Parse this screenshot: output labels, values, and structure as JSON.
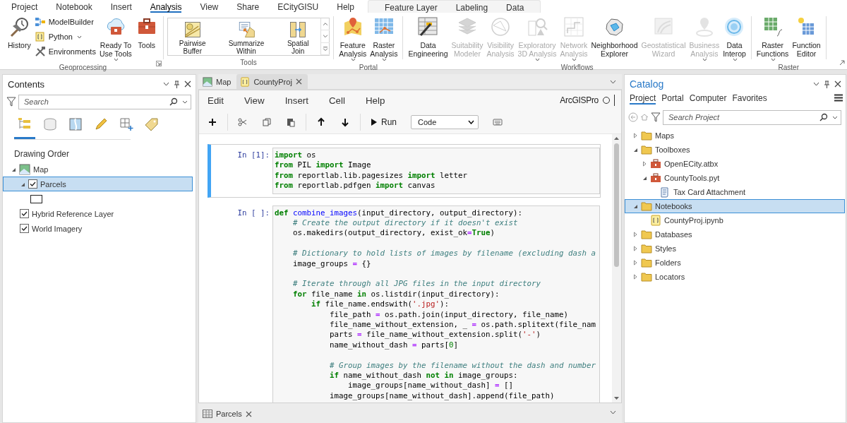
{
  "menu": {
    "tabs": [
      {
        "label": "Project",
        "selected": false
      },
      {
        "label": "Notebook",
        "selected": false
      },
      {
        "label": "Insert",
        "selected": false
      },
      {
        "label": "Analysis",
        "selected": true
      },
      {
        "label": "View",
        "selected": false
      },
      {
        "label": "Share",
        "selected": false
      },
      {
        "label": "ECityGISU",
        "selected": false
      },
      {
        "label": "Help",
        "selected": false
      }
    ],
    "context_tabs": [
      {
        "label": "Feature Layer",
        "selected": false
      },
      {
        "label": "Labeling",
        "selected": false
      },
      {
        "label": "Data",
        "selected": false
      }
    ]
  },
  "ribbon": {
    "groups": [
      {
        "label": "Geoprocessing",
        "kind": "buttons",
        "launcher": true,
        "tools": [
          {
            "kind": "large",
            "label": "History",
            "dropdown": false,
            "disabled": false
          },
          {
            "kind": "small",
            "label": "ModelBuilder",
            "dropdown": false,
            "disabled": false
          },
          {
            "kind": "small",
            "label": "Python",
            "dropdown": true,
            "disabled": false
          },
          {
            "kind": "small",
            "label": "Environments",
            "dropdown": false,
            "disabled": false
          },
          {
            "kind": "large",
            "label": "Ready To\nUse Tools",
            "dropdown": true,
            "disabled": false
          },
          {
            "kind": "large",
            "label": "Tools",
            "dropdown": false,
            "disabled": false
          }
        ]
      },
      {
        "label": "Tools",
        "kind": "gallery",
        "launcher": false,
        "tools": [
          {
            "kind": "gallery",
            "label": "Pairwise\nBuffer",
            "dropdown": false,
            "disabled": false
          },
          {
            "kind": "gallery",
            "label": "Summarize\nWithin",
            "dropdown": false,
            "disabled": false
          },
          {
            "kind": "gallery",
            "label": "Spatial\nJoin",
            "dropdown": false,
            "disabled": false
          }
        ]
      },
      {
        "label": "Portal",
        "kind": "buttons",
        "launcher": false,
        "tools": [
          {
            "kind": "large",
            "label": "Feature\nAnalysis",
            "dropdown": true,
            "disabled": false
          },
          {
            "kind": "large",
            "label": "Raster\nAnalysis",
            "dropdown": true,
            "disabled": false
          }
        ]
      },
      {
        "label": "Workflows",
        "kind": "buttons",
        "launcher": false,
        "tools": [
          {
            "kind": "large",
            "label": "Data\nEngineering",
            "dropdown": false,
            "disabled": false
          },
          {
            "kind": "large",
            "label": "Suitability\nModeler",
            "dropdown": false,
            "disabled": true
          },
          {
            "kind": "large",
            "label": "Visibility\nAnalysis",
            "dropdown": false,
            "disabled": true
          },
          {
            "kind": "large",
            "label": "Exploratory\n3D Analysis",
            "dropdown": true,
            "disabled": true
          },
          {
            "kind": "large",
            "label": "Network\nAnalysis",
            "dropdown": true,
            "disabled": true
          },
          {
            "kind": "large",
            "label": "Neighborhood\nExplorer",
            "dropdown": false,
            "disabled": false
          },
          {
            "kind": "large",
            "label": "Geostatistical\nWizard",
            "dropdown": false,
            "disabled": true
          },
          {
            "kind": "large",
            "label": "Business\nAnalysis",
            "dropdown": true,
            "disabled": true
          },
          {
            "kind": "large",
            "label": "Data\nInterop",
            "dropdown": true,
            "disabled": false
          }
        ]
      },
      {
        "label": "Raster",
        "kind": "buttons",
        "launcher": false,
        "tools": [
          {
            "kind": "large",
            "label": "Raster\nFunctions",
            "dropdown": true,
            "disabled": false
          },
          {
            "kind": "large",
            "label": "Function\nEditor",
            "dropdown": false,
            "disabled": false
          }
        ]
      }
    ]
  },
  "contents": {
    "title": "Contents",
    "search": {
      "placeholder": "Search"
    },
    "views": [
      {
        "selected": true
      },
      {
        "selected": false
      },
      {
        "selected": false
      },
      {
        "selected": false
      },
      {
        "selected": false
      },
      {
        "selected": false
      }
    ],
    "heading": "Drawing Order",
    "tree": [
      {
        "kind": "map",
        "label": "Map",
        "expanded": true,
        "selected": false,
        "children": [
          {
            "kind": "layer",
            "label": "Parcels",
            "expanded": true,
            "checked": true,
            "selected": true,
            "children": [
              {
                "kind": "symbol"
              }
            ]
          },
          {
            "kind": "layer",
            "label": "Hybrid Reference Layer",
            "checked": true,
            "selected": false
          },
          {
            "kind": "layer",
            "label": "World Imagery",
            "checked": true,
            "selected": false
          }
        ]
      }
    ]
  },
  "documents": {
    "tabs": [
      {
        "kind": "map",
        "label": "Map",
        "selected": false
      },
      {
        "kind": "notebook",
        "label": "CountyProj",
        "selected": true
      }
    ]
  },
  "notebook": {
    "menu": [
      "Edit",
      "View",
      "Insert",
      "Cell",
      "Help"
    ],
    "kernel": "ArcGISPro",
    "kernel_busy": false,
    "run_label": "Run",
    "cell_type": "Code",
    "cells": [
      {
        "prompt": "In [1]:",
        "selected": true,
        "blocks": [
          [
            [
              {
                "kind": "kw",
                "text": "import"
              },
              {
                "kind": "p",
                "text": " os"
              }
            ],
            [
              {
                "kind": "kw",
                "text": "from"
              },
              {
                "kind": "p",
                "text": " PIL "
              },
              {
                "kind": "kw",
                "text": "import"
              },
              {
                "kind": "p",
                "text": " Image"
              }
            ],
            [
              {
                "kind": "kw",
                "text": "from"
              },
              {
                "kind": "p",
                "text": " reportlab.lib.pagesizes "
              },
              {
                "kind": "kw",
                "text": "import"
              },
              {
                "kind": "p",
                "text": " letter"
              }
            ],
            [
              {
                "kind": "kw",
                "text": "from"
              },
              {
                "kind": "p",
                "text": " reportlab.pdfgen "
              },
              {
                "kind": "kw",
                "text": "import"
              },
              {
                "kind": "p",
                "text": " canvas"
              }
            ]
          ]
        ]
      },
      {
        "prompt": "In [ ]:",
        "selected": false,
        "blocks": [
          [
            [
              {
                "kind": "kw",
                "text": "def "
              },
              {
                "kind": "fn",
                "text": "combine_images"
              },
              {
                "kind": "p",
                "text": "(input_directory, output_directory):"
              }
            ],
            [
              {
                "kind": "cm",
                "text": "    # Create the output directory if it doesn't exist"
              }
            ],
            [
              {
                "kind": "p",
                "text": "    os.makedirs(output_directory, exist_ok"
              },
              {
                "kind": "op",
                "text": "="
              },
              {
                "kind": "kw",
                "text": "True"
              },
              {
                "kind": "p",
                "text": ")"
              }
            ]
          ],
          [
            [
              {
                "kind": "cm",
                "text": "    # Dictionary to hold lists of images by filename (excluding dash a"
              }
            ],
            [
              {
                "kind": "p",
                "text": "    image_groups "
              },
              {
                "kind": "op",
                "text": "="
              },
              {
                "kind": "p",
                "text": " {}"
              }
            ]
          ],
          [
            [
              {
                "kind": "cm",
                "text": "    # Iterate through all JPG files in the input directory"
              }
            ],
            [
              {
                "kind": "kw",
                "text": "    for"
              },
              {
                "kind": "p",
                "text": " file_name "
              },
              {
                "kind": "kw",
                "text": "in"
              },
              {
                "kind": "p",
                "text": " os.listdir(input_directory):"
              }
            ],
            [
              {
                "kind": "kw",
                "text": "        if"
              },
              {
                "kind": "p",
                "text": " file_name.endswith("
              },
              {
                "kind": "str",
                "text": "'.jpg'"
              },
              {
                "kind": "p",
                "text": "):"
              }
            ],
            [
              {
                "kind": "p",
                "text": "            file_path "
              },
              {
                "kind": "op",
                "text": "="
              },
              {
                "kind": "p",
                "text": " os.path.join(input_directory, file_name)"
              }
            ],
            [
              {
                "kind": "p",
                "text": "            file_name_without_extension, _ "
              },
              {
                "kind": "op",
                "text": "="
              },
              {
                "kind": "p",
                "text": " os.path.splitext(file_nam"
              }
            ],
            [
              {
                "kind": "p",
                "text": "            parts "
              },
              {
                "kind": "op",
                "text": "="
              },
              {
                "kind": "p",
                "text": " file_name_without_extension.split("
              },
              {
                "kind": "str",
                "text": "'-'"
              },
              {
                "kind": "p",
                "text": ")"
              }
            ],
            [
              {
                "kind": "p",
                "text": "            name_without_dash "
              },
              {
                "kind": "op",
                "text": "="
              },
              {
                "kind": "p",
                "text": " parts["
              },
              {
                "kind": "num",
                "text": "0"
              },
              {
                "kind": "p",
                "text": "]"
              }
            ]
          ],
          [
            [
              {
                "kind": "cm",
                "text": "            # Group images by the filename without the dash and number"
              }
            ],
            [
              {
                "kind": "kw",
                "text": "            if"
              },
              {
                "kind": "p",
                "text": " name_without_dash "
              },
              {
                "kind": "kw",
                "text": "not in"
              },
              {
                "kind": "p",
                "text": " image_groups:"
              }
            ],
            [
              {
                "kind": "p",
                "text": "                image_groups[name_without_dash] "
              },
              {
                "kind": "op",
                "text": "="
              },
              {
                "kind": "p",
                "text": " []"
              }
            ],
            [
              {
                "kind": "p",
                "text": "            image_groups[name_without_dash].append(file_path)"
              }
            ]
          ]
        ]
      }
    ]
  },
  "bottom_tabs": [
    {
      "label": "Parcels",
      "selected": false
    }
  ],
  "catalog": {
    "title": "Catalog",
    "tabs": [
      {
        "label": "Project",
        "selected": true
      },
      {
        "label": "Portal",
        "selected": false
      },
      {
        "label": "Computer",
        "selected": false
      },
      {
        "label": "Favorites",
        "selected": false
      }
    ],
    "search": {
      "placeholder": "Search Project"
    },
    "tree": [
      {
        "kind": "folder",
        "label": "Maps",
        "expanded": false,
        "selected": false
      },
      {
        "kind": "folder",
        "label": "Toolboxes",
        "expanded": true,
        "selected": false,
        "children": [
          {
            "kind": "toolbox",
            "label": "OpenECity.atbx",
            "expanded": false,
            "selected": false
          },
          {
            "kind": "toolbox",
            "label": "CountyTools.pyt",
            "expanded": true,
            "selected": false,
            "children": [
              {
                "kind": "script",
                "label": "Tax Card Attachment",
                "selected": false
              }
            ]
          }
        ]
      },
      {
        "kind": "folder",
        "label": "Notebooks",
        "expanded": true,
        "selected": true,
        "children": [
          {
            "kind": "notebook",
            "label": "CountyProj.ipynb",
            "selected": false
          }
        ]
      },
      {
        "kind": "folder",
        "label": "Databases",
        "expanded": false,
        "selected": false
      },
      {
        "kind": "folder",
        "label": "Styles",
        "expanded": false,
        "selected": false
      },
      {
        "kind": "folder",
        "label": "Folders",
        "expanded": false,
        "selected": false
      },
      {
        "kind": "folder",
        "label": "Locators",
        "expanded": false,
        "selected": false
      }
    ]
  }
}
